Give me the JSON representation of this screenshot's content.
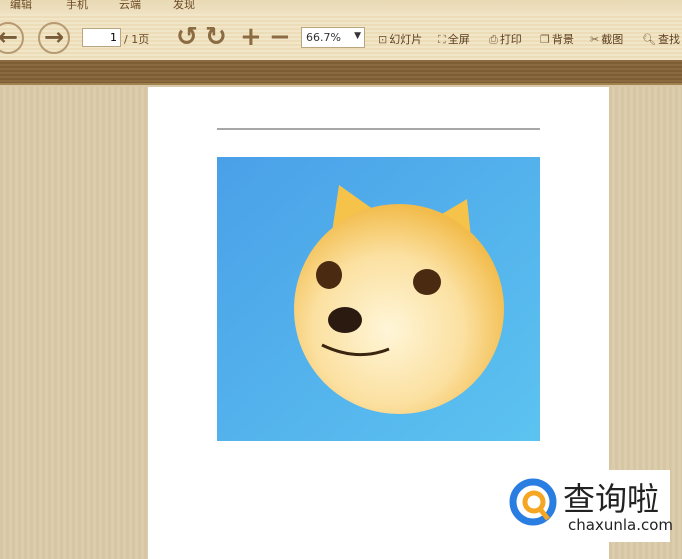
{
  "tabs": [
    "编辑",
    "手机",
    "云端",
    "发现"
  ],
  "toolbar": {
    "back_icon": "arrow-left-icon",
    "forward_icon": "arrow-right-icon",
    "page_value": "1",
    "page_total": "/ 1页",
    "zoom_value": "66.7%",
    "buttons": [
      {
        "label": "幻灯片",
        "icon": "slideshow-icon"
      },
      {
        "label": "全屏",
        "icon": "fullscreen-icon"
      },
      {
        "label": "打印",
        "icon": "print-icon"
      },
      {
        "label": "背景",
        "icon": "background-icon"
      },
      {
        "label": "截图",
        "icon": "scissors-icon"
      },
      {
        "label": "查找",
        "icon": "search-icon"
      }
    ]
  },
  "watermark": {
    "title": "查询啦",
    "url": "chaxunla.com"
  },
  "colors": {
    "toolbar": "#efe2c2",
    "brown_bar": "#8a6a3e",
    "image_bg": "#4aa8ea"
  }
}
